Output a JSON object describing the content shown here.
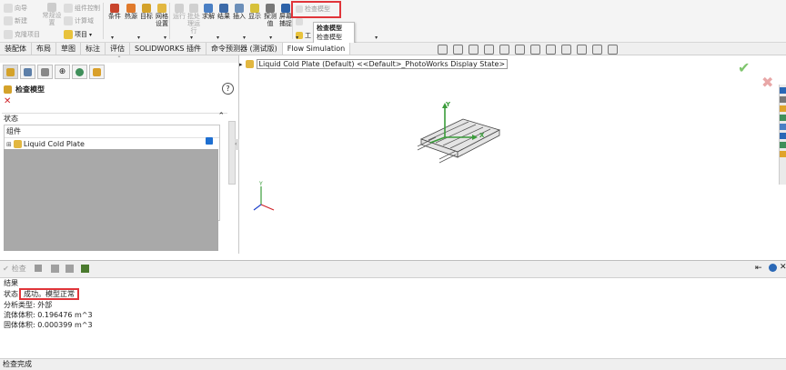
{
  "ribbon": {
    "small_left": [
      "向导",
      "新建",
      "克隆项目"
    ],
    "small_mid": [
      "常规设置",
      "组件控制",
      "计算域",
      "项目"
    ],
    "buttons1": [
      "条件",
      "热源",
      "目标",
      "网格设置"
    ],
    "buttons2": [
      "运行",
      "批处理运行",
      "求解",
      "结果",
      "插入",
      "显示",
      "探测值",
      "屏幕捕捉"
    ],
    "check_model": "检查模型",
    "tool_label": "工"
  },
  "tooltip": {
    "title": "检查模型",
    "desc": "检查模型"
  },
  "tabs": [
    "装配体",
    "布局",
    "草图",
    "标注",
    "评估",
    "SOLIDWORKS 插件",
    "命令预测器 (测试版)",
    "Flow Simulation"
  ],
  "panel": {
    "title": "检查模型",
    "help": "?",
    "close": "✕",
    "status_section": "状态",
    "group_label": "组件",
    "component": "Liquid Cold Plate"
  },
  "viewport": {
    "tree_item": "Liquid Cold Plate (Default) <<Default>_PhotoWorks Display State>",
    "axis_y": "Y",
    "axis_x": "X"
  },
  "bottom": {
    "check_label": "检查",
    "result_header": "结果",
    "status_label": "状态",
    "status_value": "成功。模型正常",
    "analysis_type": "分析类型: 外部",
    "fluid_volume": "流体体积: 0.196476 m^3",
    "solid_volume": "固体体积: 0.000399 m^3"
  },
  "statusbar": "检查完成",
  "colors": {
    "accent_red": "#e0353a",
    "check_green": "#7fc56d",
    "gray_fill": "#a9a9a9"
  }
}
